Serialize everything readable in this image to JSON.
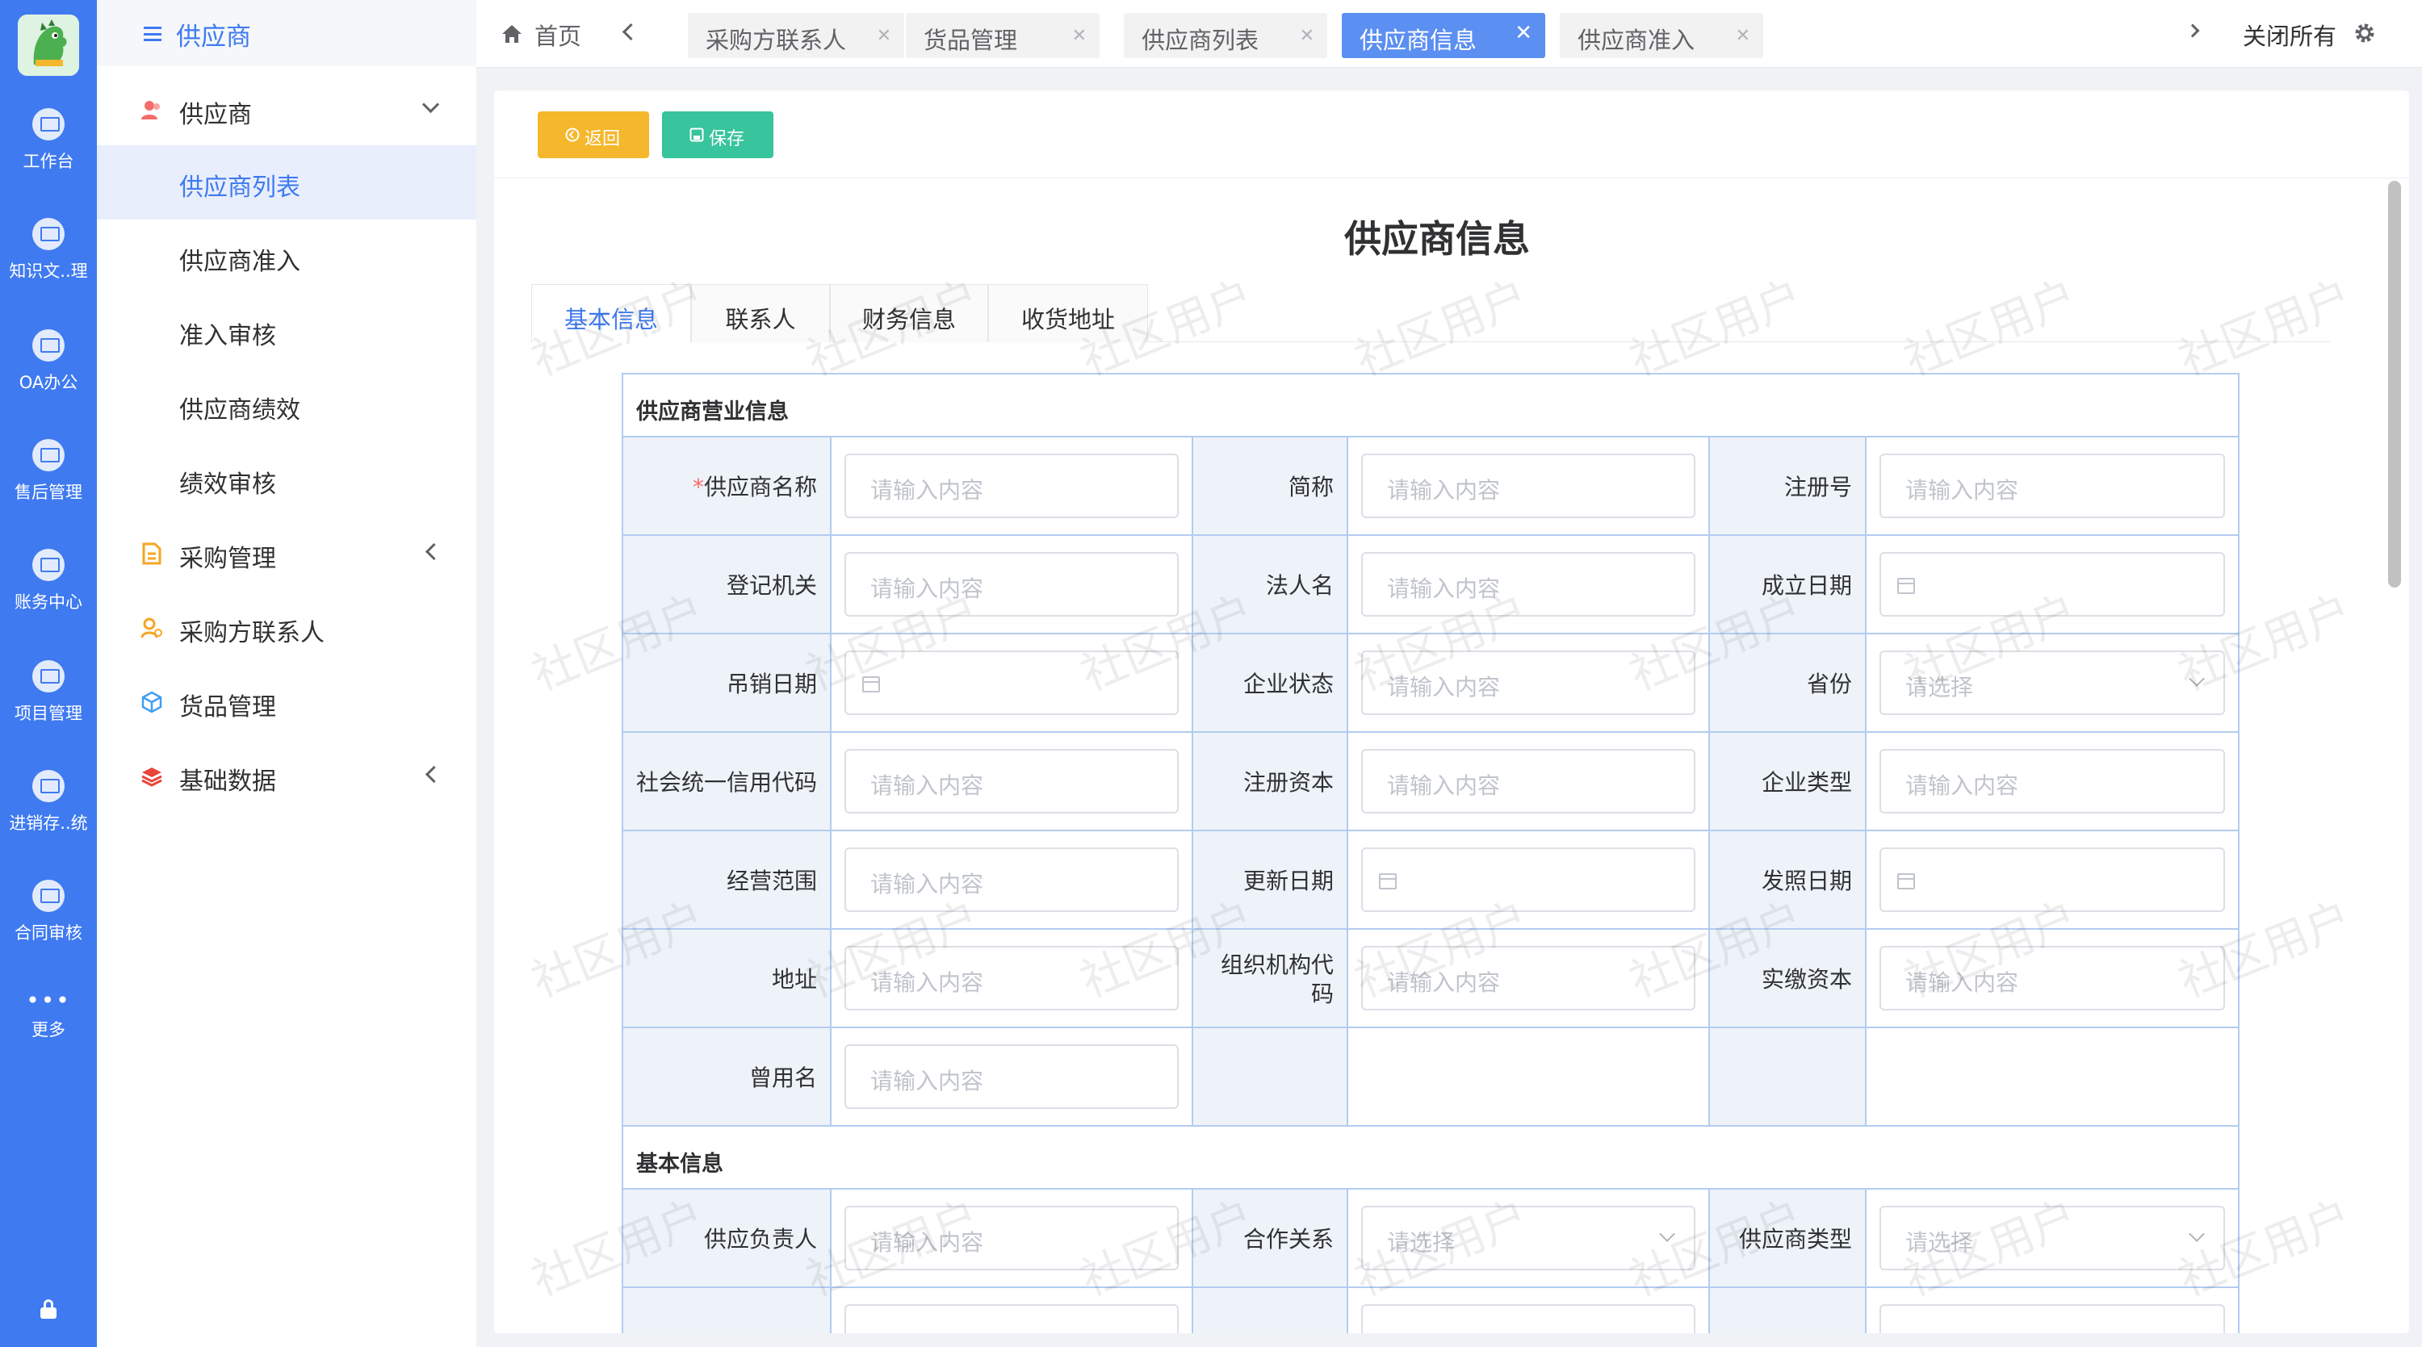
{
  "rail": {
    "items": [
      {
        "label": "工作台",
        "icon": "monitor-icon"
      },
      {
        "label": "知识文..理",
        "icon": "monitor-icon"
      },
      {
        "label": "OA办公",
        "icon": "monitor-icon"
      },
      {
        "label": "售后管理",
        "icon": "monitor-icon"
      },
      {
        "label": "账务中心",
        "icon": "monitor-icon"
      },
      {
        "label": "项目管理",
        "icon": "monitor-icon"
      },
      {
        "label": "进销存..统",
        "icon": "monitor-icon"
      },
      {
        "label": "合同审核",
        "icon": "monitor-icon"
      }
    ],
    "more_label": "更多",
    "more_dots": "•••",
    "color": "#3f7af0"
  },
  "sidebar": {
    "title": "供应商",
    "group": {
      "label": "供应商",
      "icon": "users-icon"
    },
    "sub_items": [
      {
        "label": "供应商列表",
        "active": true
      },
      {
        "label": "供应商准入"
      },
      {
        "label": "准入审核"
      },
      {
        "label": "供应商绩效"
      },
      {
        "label": "绩效审核"
      }
    ],
    "items": [
      {
        "label": "采购管理",
        "icon": "document-icon"
      },
      {
        "label": "采购方联系人",
        "icon": "contact-icon"
      },
      {
        "label": "货品管理",
        "icon": "cube-icon"
      },
      {
        "label": "基础数据",
        "icon": "layers-icon"
      }
    ]
  },
  "tabbar": {
    "home_label": "首页",
    "tabs": [
      {
        "label": "采购方联系人",
        "close": "✕"
      },
      {
        "label": "货品管理",
        "close": "✕"
      },
      {
        "label": "供应商列表",
        "close": "✕"
      },
      {
        "label": "供应商信息",
        "close": "✕",
        "active": true
      },
      {
        "label": "供应商准入",
        "close": "✕"
      }
    ],
    "close_all": "关闭所有"
  },
  "toolbar": {
    "back_label": "返回",
    "save_label": "保存"
  },
  "page_title": "供应商信息",
  "form_tabs": [
    "基本信息",
    "联系人",
    "财务信息",
    "收货地址"
  ],
  "sections": {
    "business": "供应商营业信息",
    "basic": "基本信息"
  },
  "fields": {
    "supplier_name": {
      "label": "供应商名称",
      "required": "*",
      "placeholder": "请输入内容"
    },
    "short_name": {
      "label": "简称",
      "placeholder": "请输入内容"
    },
    "reg_no": {
      "label": "注册号",
      "placeholder": "请输入内容"
    },
    "reg_authority": {
      "label": "登记机关",
      "placeholder": "请输入内容"
    },
    "legal_person": {
      "label": "法人名",
      "placeholder": "请输入内容"
    },
    "found_date": {
      "label": "成立日期"
    },
    "revoke_date": {
      "label": "吊销日期"
    },
    "company_status": {
      "label": "企业状态",
      "placeholder": "请输入内容"
    },
    "province": {
      "label": "省份",
      "placeholder": "请选择"
    },
    "credit_code": {
      "label": "社会统一信用代码",
      "placeholder": "请输入内容"
    },
    "reg_capital": {
      "label": "注册资本",
      "placeholder": "请输入内容"
    },
    "company_type": {
      "label": "企业类型",
      "placeholder": "请输入内容"
    },
    "scope": {
      "label": "经营范围",
      "placeholder": "请输入内容"
    },
    "update_date": {
      "label": "更新日期"
    },
    "issue_date": {
      "label": "发照日期"
    },
    "address": {
      "label": "地址",
      "placeholder": "请输入内容"
    },
    "org_code": {
      "label": "组织机构代码",
      "placeholder": "请输入内容"
    },
    "paid_capital": {
      "label": "实缴资本",
      "placeholder": "请输入内容"
    },
    "former_name": {
      "label": "曾用名",
      "placeholder": "请输入内容"
    },
    "owner": {
      "label": "供应负责人",
      "placeholder": "请输入内容"
    },
    "cooperation": {
      "label": "合作关系",
      "placeholder": "请选择"
    },
    "supplier_type": {
      "label": "供应商类型",
      "placeholder": "请选择"
    }
  },
  "watermark": "社区用户"
}
